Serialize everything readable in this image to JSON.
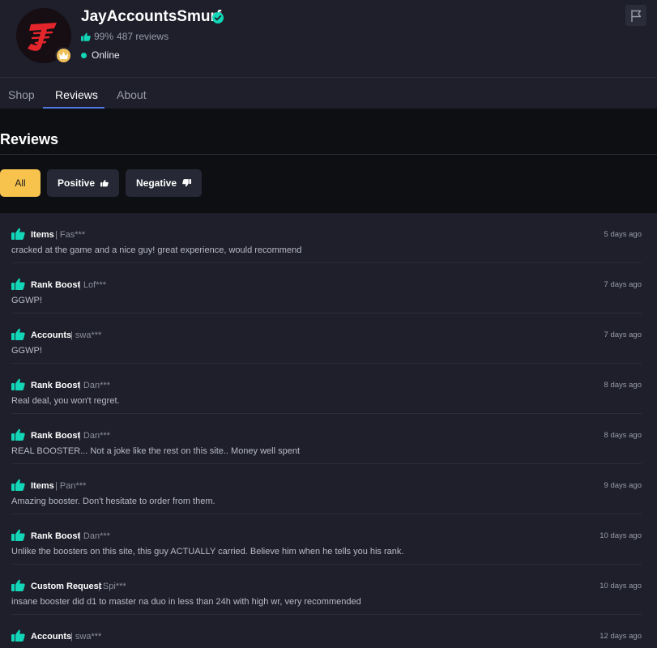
{
  "seller": {
    "name": "JayAccountsSmurf",
    "rating": "99%",
    "reviews_count": "487 reviews",
    "status": "Online"
  },
  "tabs": [
    {
      "label": "Shop"
    },
    {
      "label": "Reviews"
    },
    {
      "label": "About"
    }
  ],
  "section": {
    "title": "Reviews"
  },
  "filters": {
    "all": "All",
    "positive": "Positive",
    "negative": "Negative"
  },
  "colors": {
    "accent": "#f7c34d",
    "positive": "#12d6b7",
    "tab_underline": "#4f78e4"
  },
  "reviews": [
    {
      "category": "Items",
      "user": "Fas***",
      "date": "5 days ago",
      "text": "cracked at the game and a nice guy! great experience, would recommend"
    },
    {
      "category": "Rank Boost",
      "user": "Lof***",
      "date": "7 days ago",
      "text": "GGWP!"
    },
    {
      "category": "Accounts",
      "user": "swa***",
      "date": "7 days ago",
      "text": "GGWP!"
    },
    {
      "category": "Rank Boost",
      "user": "Dan***",
      "date": "8 days ago",
      "text": "Real deal, you won't regret."
    },
    {
      "category": "Rank Boost",
      "user": "Dan***",
      "date": "8 days ago",
      "text": "REAL BOOSTER... Not a joke like the rest on this site.. Money well spent"
    },
    {
      "category": "Items",
      "user": "Pan***",
      "date": "9 days ago",
      "text": "Amazing booster. Don't hesitate to order from them."
    },
    {
      "category": "Rank Boost",
      "user": "Dan***",
      "date": "10 days ago",
      "text": "Unlike the boosters on this site, this guy ACTUALLY carried. Believe him when he tells you his rank."
    },
    {
      "category": "Custom Request",
      "user": "Spi***",
      "date": "10 days ago",
      "text": "insane booster did d1 to master na duo in less than 24h with high wr, very recommended"
    },
    {
      "category": "Accounts",
      "user": "swa***",
      "date": "12 days ago",
      "text": ""
    }
  ]
}
